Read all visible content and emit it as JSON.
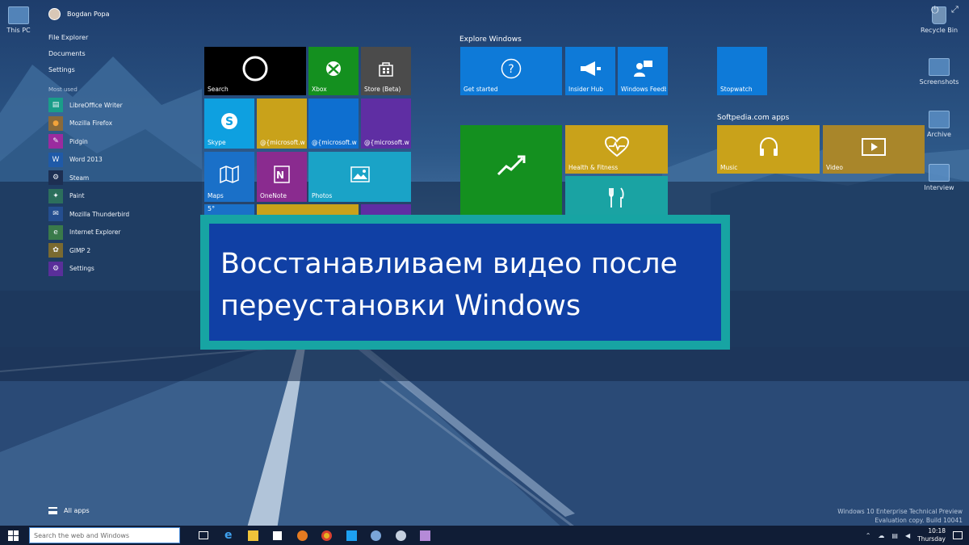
{
  "desktop": {
    "icons_left": [
      {
        "label": "This PC",
        "icon": "monitor-icon"
      }
    ],
    "icons_right": [
      {
        "label": "Recycle Bin",
        "icon": "recycle-bin-icon"
      },
      {
        "label": "Screenshots",
        "icon": "folder-icon"
      },
      {
        "label": "Archive",
        "icon": "folder-icon"
      },
      {
        "label": "Interview",
        "icon": "document-icon"
      }
    ]
  },
  "start_menu": {
    "user_name": "Bogdan Popa",
    "power_glyph": "⏻",
    "expand_glyph": "⤢",
    "system_links": [
      "File Explorer",
      "Documents",
      "Settings"
    ],
    "most_used_heading": "Most used",
    "apps": [
      {
        "label": "LibreOffice Writer",
        "icon": "libreoffice-writer-icon",
        "color": "#1a9d89",
        "glyph": "▤"
      },
      {
        "label": "Mozilla Firefox",
        "icon": "firefox-icon",
        "color": "#d9781c",
        "glyph": "●"
      },
      {
        "label": "Pidgin",
        "icon": "pidgin-icon",
        "color": "#9b2b9f",
        "glyph": "✎"
      },
      {
        "label": "Word 2013",
        "icon": "word-icon",
        "color": "#1f5aa8",
        "glyph": "W"
      },
      {
        "label": "Steam",
        "icon": "steam-icon",
        "color": "#1d2f52",
        "glyph": "⚙"
      },
      {
        "label": "Paint",
        "icon": "paint-icon",
        "color": "#2c8f5c",
        "glyph": "✦"
      },
      {
        "label": "Mozilla Thunderbird",
        "icon": "thunderbird-icon",
        "color": "#244e8f",
        "glyph": "✉"
      },
      {
        "label": "Internet Explorer",
        "icon": "internet-explorer-icon",
        "color": "#3a8a2a",
        "glyph": "e"
      },
      {
        "label": "GIMP 2",
        "icon": "gimp-icon",
        "color": "#7a6a30",
        "glyph": "✿"
      },
      {
        "label": "Settings",
        "icon": "settings-gear-icon",
        "color": "#5a2f9a",
        "glyph": "⚙"
      }
    ],
    "all_apps_label": "All apps"
  },
  "tiles": {
    "search": "Search",
    "xbox": "Xbox",
    "store": "Store (Beta)",
    "skype": "Skype",
    "ms_mail_1": "@{microsoft.win",
    "ms_mail_2": "@{microsoft.win",
    "ms_mail_3": "@{microsoft.win",
    "maps": "Maps",
    "onenote": "OneNote",
    "photos": "Photos",
    "weather": "5°",
    "explore_heading": "Explore Windows",
    "get_started": "Get started",
    "insider_hub": "Insider Hub",
    "windows_feedback": "Windows Feedb",
    "stopwatch": "Stopwatch",
    "health": "Health & Fitness",
    "softpedia_heading": "Softpedia.com apps",
    "music": "Music",
    "video": "Video"
  },
  "banner": {
    "line1": "Восстанавливаем видео после",
    "line2": "переустановки Windows"
  },
  "watermark": {
    "line1": "Windows 10 Enterprise Technical Preview",
    "line2": "Evaluation copy. Build 10041"
  },
  "taskbar": {
    "search_placeholder": "Search the web and Windows",
    "time": "10:18",
    "day": "Thursday"
  },
  "colors": {
    "banner_border": "#17a4a3",
    "banner_fill": "#1040a5",
    "tile_blue": "#0e7ad8",
    "tile_green": "#14901f",
    "tile_gold": "#c9a21a"
  }
}
